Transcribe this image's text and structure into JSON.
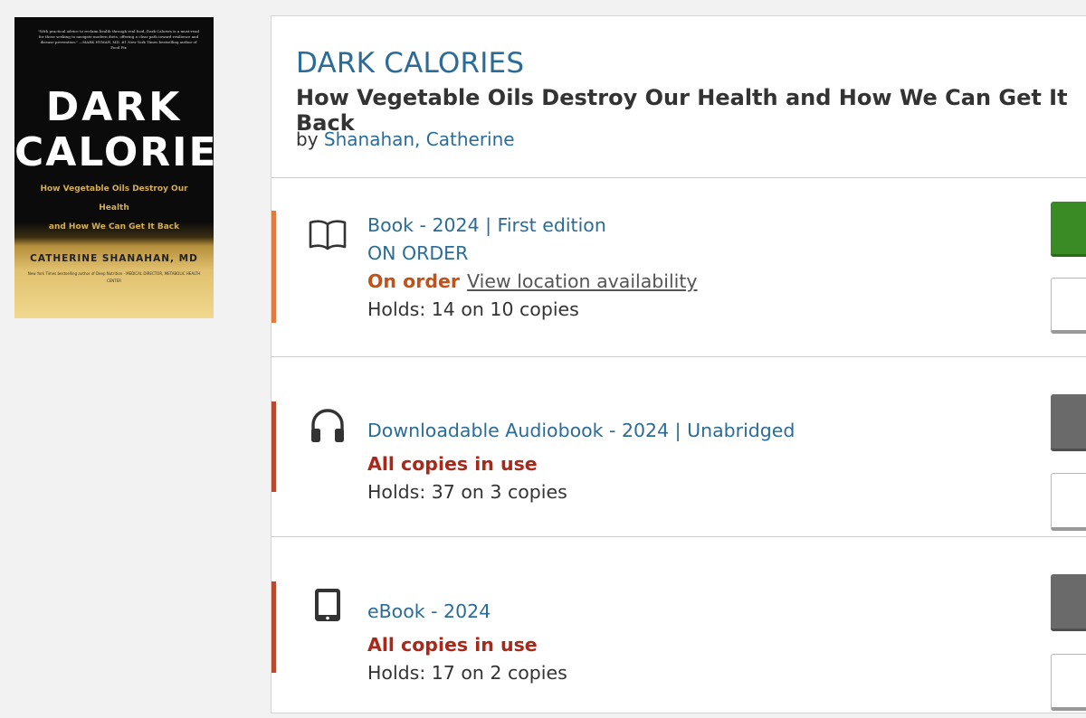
{
  "cover": {
    "blurb": "\"With practical advice to reclaim health through real food, Dark Calories is a must-read for those seeking to navigate modern diets, offering a clear path toward resilience and disease prevention.\" —MARK HYMAN, MD, #1 New York Times bestselling author of Food Fix",
    "title_line1": "DARK",
    "title_line2": "CALORIES",
    "subtitle_line1": "How Vegetable Oils Destroy Our Health",
    "subtitle_line2": "and How We Can Get It Back",
    "author": "CATHERINE SHANAHAN, MD",
    "author_note": "New York Times bestselling author of Deep Nutrition · MEDICAL DIRECTOR, METABOLIC HEALTH CENTER"
  },
  "book": {
    "title": "DARK CALORIES",
    "subtitle": "How Vegetable Oils Destroy Our Health and How We Can Get It Back",
    "by_label": "by",
    "author": "Shanahan, Catherine"
  },
  "formats": [
    {
      "icon": "book-icon",
      "format_label": "Book - 2024 | First edition",
      "on_order_label": "ON ORDER",
      "status": "On order",
      "view_link": "View location availability",
      "holds": "Holds: 14 on 10 copies",
      "accent_color": "#e07a3f"
    },
    {
      "icon": "headphones-icon",
      "format_label": "Downloadable Audiobook - 2024 | Unabridged",
      "status": "All copies in use",
      "holds": "Holds: 37 on 3 copies",
      "accent_color": "#b8482e"
    },
    {
      "icon": "tablet-icon",
      "format_label": "eBook - 2024",
      "status": "All copies in use",
      "holds": "Holds: 17 on 2 copies",
      "accent_color": "#b8482e"
    }
  ],
  "colors": {
    "link": "#2a6c97",
    "on_order_status": "#c0531a",
    "unavailable_status": "#a8281a",
    "place_hold_green": "#3a8a25",
    "action_gray": "#6a6a6a"
  }
}
